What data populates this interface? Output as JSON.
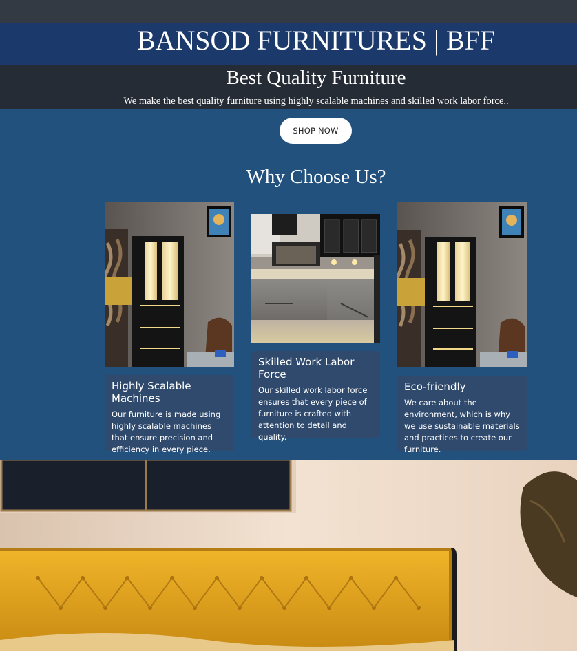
{
  "header": {
    "brand_title": "BANSOD FURNITURES | BFF"
  },
  "hero": {
    "heading": "Best Quality Furniture",
    "text": "We make the best quality furniture using highly scalable machines and skilled work labor force..",
    "button_label": "SHOP NOW"
  },
  "why": {
    "heading": "Why Choose Us?",
    "cards": [
      {
        "title": "Highly Scalable Machines",
        "text": "Our furniture is made using highly scalable machines that ensure precision and efficiency in every piece.",
        "image": "lit-display-cabinet-photo"
      },
      {
        "title": "Skilled Work Labor Force",
        "text": "Our skilled work labor force ensures that every piece of furniture is crafted with attention to detail and quality.",
        "image": "modular-kitchen-photo"
      },
      {
        "title": "Eco-friendly",
        "text": "We care about the environment, which is why we use sustainable materials and practices to create our furniture.",
        "image": "lit-display-cabinet-photo"
      }
    ]
  },
  "banner": {
    "image": "yellow-tufted-sofa-photo"
  },
  "colors": {
    "top_bar": "#343a43",
    "brand_bar": "#1b3a6b",
    "hero_strip": "#262c36",
    "section_bg": "#22517e",
    "card_bg": "#2f4a6d",
    "button_bg": "#ffffff"
  }
}
